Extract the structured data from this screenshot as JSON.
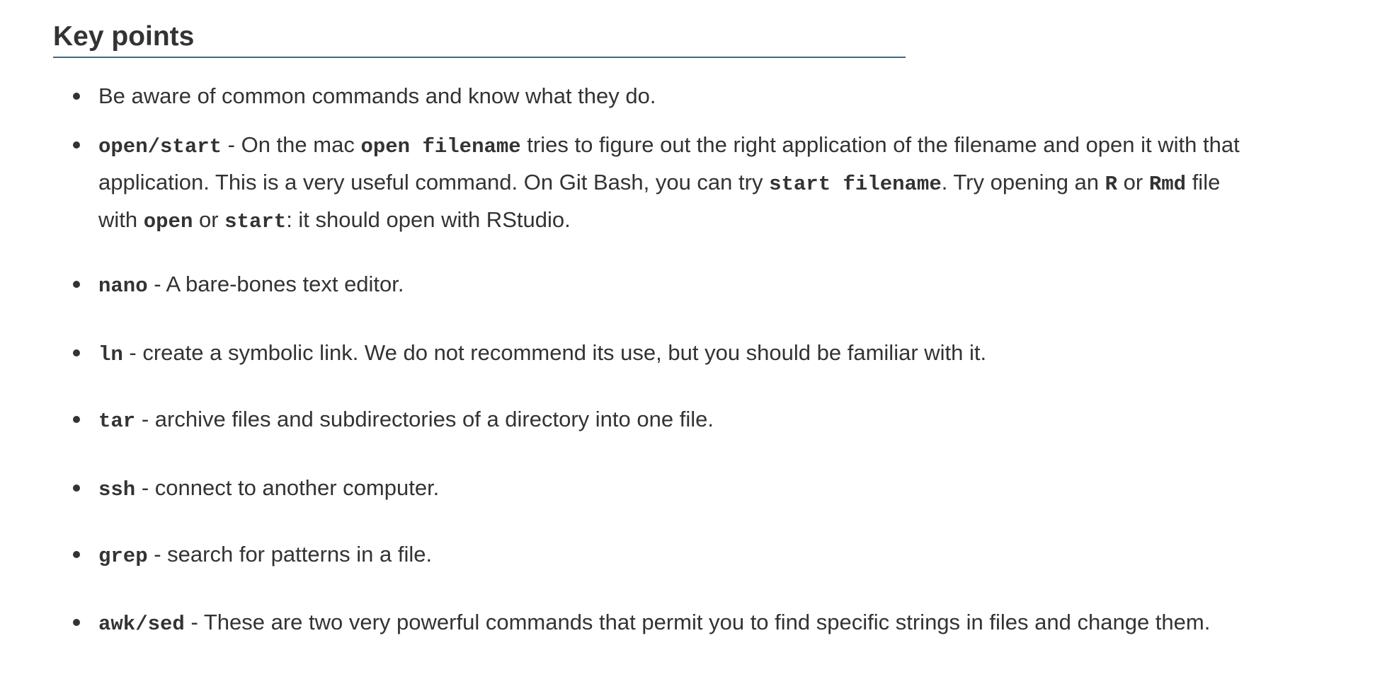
{
  "section": {
    "title": "Key points"
  },
  "items": [
    {
      "parts": [
        "Be aware of common commands and know what they do."
      ]
    },
    {
      "code1": "open/start",
      "text1": " - On the mac ",
      "code2": "open filename",
      "text2": " tries to figure out the right application of the filename and open it with that",
      "text3": "application. This is a very useful command. On Git Bash, you can try ",
      "code3": "start filename",
      "text4": ". Try opening an ",
      "code4": "R",
      "text5": " or ",
      "code5": "Rmd",
      "text6": " file",
      "text7": "with ",
      "code6": "open",
      "text8": " or ",
      "code7": "start",
      "text9": ": it should open with RStudio."
    },
    {
      "code": "nano",
      "text": " - A bare-bones text editor."
    },
    {
      "code": "ln",
      "text": " - create a symbolic link. We do not recommend its use, but you should be familiar with it."
    },
    {
      "code": "tar",
      "text": " - archive files and subdirectories of a directory into one file."
    },
    {
      "code": "ssh",
      "text": " - connect to another computer."
    },
    {
      "code": "grep",
      "text": " - search for patterns in a file."
    },
    {
      "code": "awk/sed",
      "text": " - These are two very powerful commands that permit you to find specific strings in files and change them."
    }
  ]
}
